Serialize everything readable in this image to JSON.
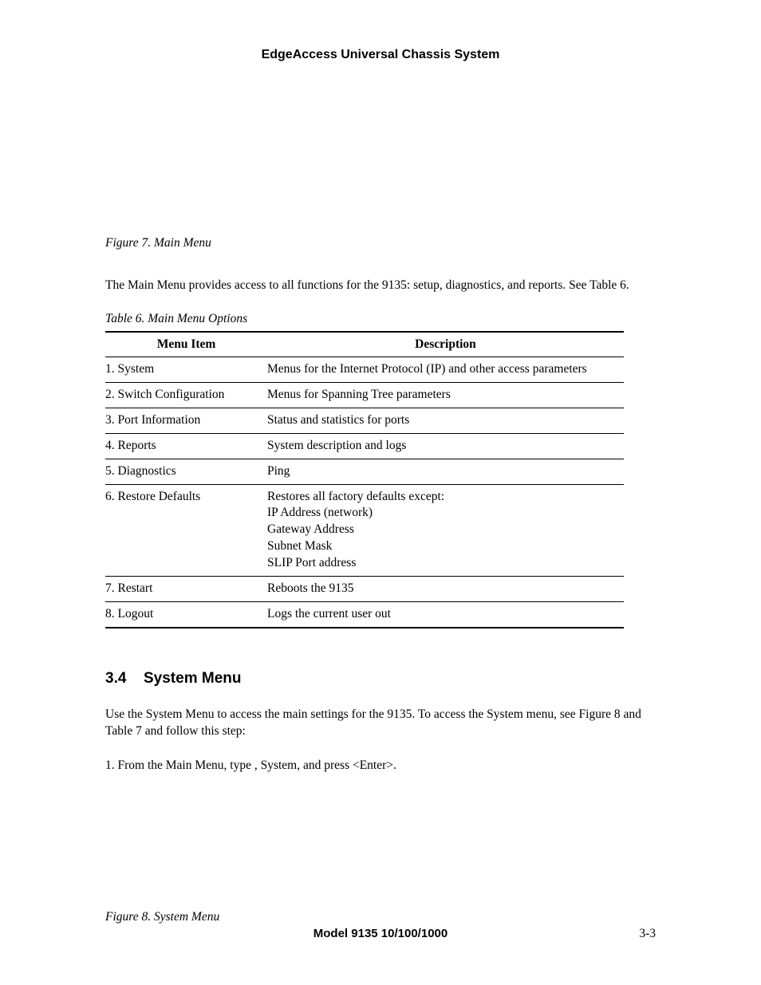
{
  "header": {
    "title": "EdgeAccess Universal Chassis System"
  },
  "figure7": {
    "caption": "Figure 7.  Main Menu"
  },
  "para1": "The Main Menu provides access to all functions for the 9135:  setup, diagnostics, and reports.  See Table 6.",
  "table6": {
    "caption": "Table 6.  Main Menu Options",
    "headers": {
      "col1": "Menu Item",
      "col2": "Description"
    },
    "rows": [
      {
        "item": "1.  System",
        "desc": "Menus for the Internet Protocol (IP) and other access parameters"
      },
      {
        "item": "2.  Switch Configuration",
        "desc": "Menus for Spanning Tree parameters"
      },
      {
        "item": "3.  Port Information",
        "desc": "Status and statistics for ports"
      },
      {
        "item": "4.  Reports",
        "desc": "System description and logs"
      },
      {
        "item": "5.  Diagnostics",
        "desc": "Ping"
      },
      {
        "item": "6.  Restore Defaults",
        "desc": "Restores all factory defaults except:\nIP Address (network)\nGateway Address\nSubnet Mask\nSLIP Port address"
      },
      {
        "item": "7.  Restart",
        "desc": "Reboots the 9135"
      },
      {
        "item": "8.  Logout",
        "desc": "Logs the current user out"
      }
    ]
  },
  "section34": {
    "number": "3.4",
    "title": "System Menu",
    "intro": "Use the System Menu to access the main settings for the 9135.  To access the System menu, see Figure 8 and Table 7 and follow this step:",
    "step1": "1.   From the Main Menu, type   , System, and press <Enter>."
  },
  "figure8": {
    "caption": "Figure 8.  System Menu"
  },
  "footer": {
    "center": "Model 9135 10/100/1000",
    "right": "3-3"
  }
}
